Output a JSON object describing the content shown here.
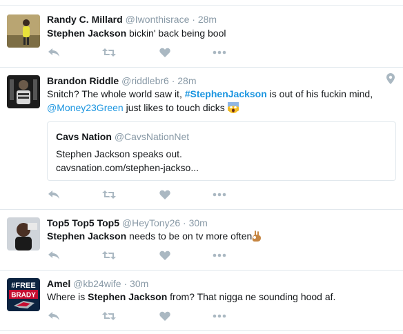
{
  "tweets": [
    {
      "name": "Randy C. Millard",
      "handle": "@Iwonthisrace",
      "time": "28m",
      "text_bold": "Stephen Jackson",
      "text_rest": " bickin' back being bool"
    },
    {
      "name": "Brandon Riddle",
      "handle": "@riddlebr6",
      "time": "28m",
      "text_a": "Snitch? The whole world saw it, ",
      "hashtag": "#StephenJackson",
      "text_b": " is out of his fuckin mind,",
      "mention": "@Money23Green",
      "text_c": " just likes to touch dicks ",
      "quote": {
        "name": "Cavs Nation",
        "handle": "@CavsNationNet",
        "line1": "Stephen Jackson speaks out.",
        "line2": "cavsnation.com/stephen-jackso..."
      }
    },
    {
      "name": "Top5 Top5 Top5",
      "handle": "@HeyTony26",
      "time": "30m",
      "text_bold": "Stephen Jackson",
      "text_rest": " needs to be on tv more often"
    },
    {
      "name": "Amel",
      "handle": "@kb24wife",
      "time": "30m",
      "text_a": "Where is ",
      "text_bold": "Stephen Jackson",
      "text_rest": " from? That nigga ne sounding hood af.",
      "avatar_line1": "#FREE",
      "avatar_line2": "BRADY"
    }
  ],
  "separator": "·",
  "icons": [
    "reply-icon",
    "retweet-icon",
    "like-icon",
    "more-icon",
    "location-pin-icon"
  ],
  "colors": {
    "link": "#1b95e0",
    "muted": "#8899a6",
    "icon": "#aab8c2",
    "border": "#e1e8ed"
  }
}
